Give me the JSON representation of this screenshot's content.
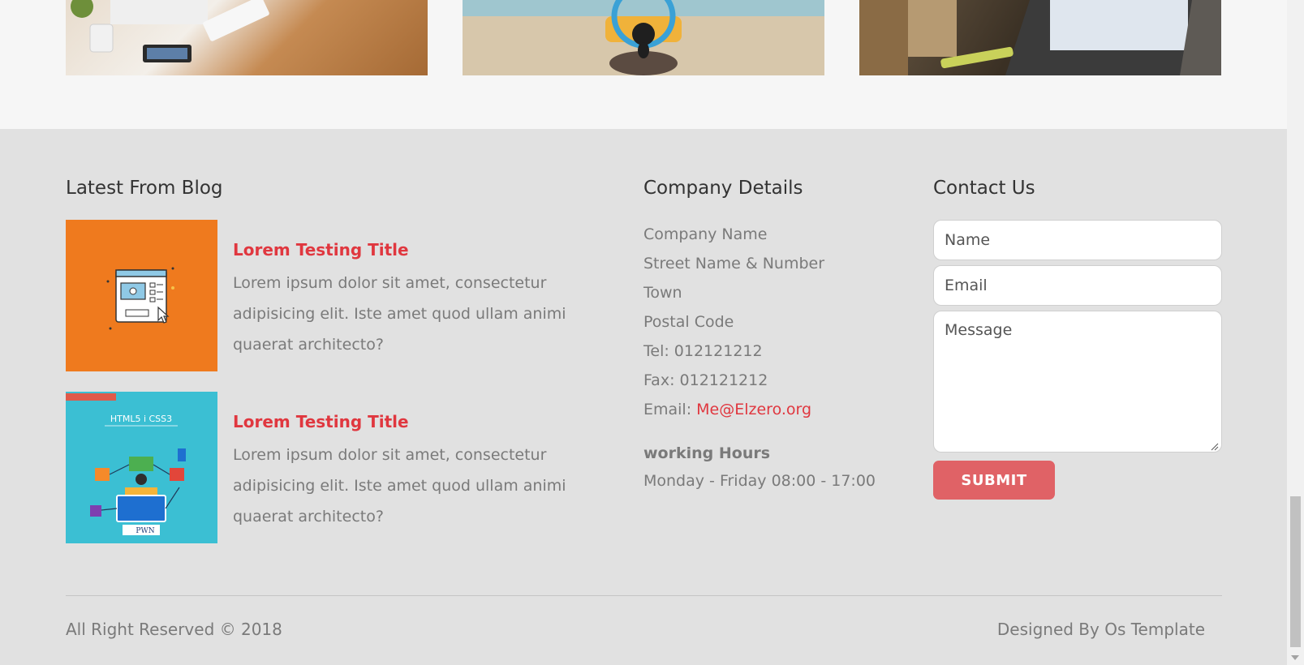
{
  "footer": {
    "blog": {
      "title": "Latest From Blog",
      "posts": [
        {
          "title": "Lorem Testing Title",
          "text": "Lorem ipsum dolor sit amet, consectetur adipisicing elit. Iste amet quod ullam animi quaerat architecto?"
        },
        {
          "title": "Lorem Testing Title",
          "text": "Lorem ipsum dolor sit amet, consectetur adipisicing elit. Iste amet quod ullam animi quaerat architecto?",
          "thumb_text": [
            "HTML5 i CSS3",
            "PWN"
          ]
        }
      ]
    },
    "company": {
      "title": "Company Details",
      "name": "Company Name",
      "street": "Street Name & Number",
      "town": "Town",
      "postal": "Postal Code",
      "tel": "Tel: 012121212",
      "fax": "Fax: 012121212",
      "email_label": "Email: ",
      "email": "Me@Elzero.org",
      "hours_title": "working Hours",
      "hours": "Monday - Friday 08:00 - 17:00"
    },
    "contact": {
      "title": "Contact Us",
      "name_placeholder": "Name",
      "email_placeholder": "Email",
      "message_placeholder": "Message",
      "submit_label": "SUBMIT"
    },
    "copyright": "All Right Reserved © 2018",
    "credit": "Designed By Os Template"
  },
  "colors": {
    "accent": "#e0373f",
    "button": "#e06266",
    "footer_bg": "#e1e1e1",
    "text_muted": "#7a7a7a"
  }
}
